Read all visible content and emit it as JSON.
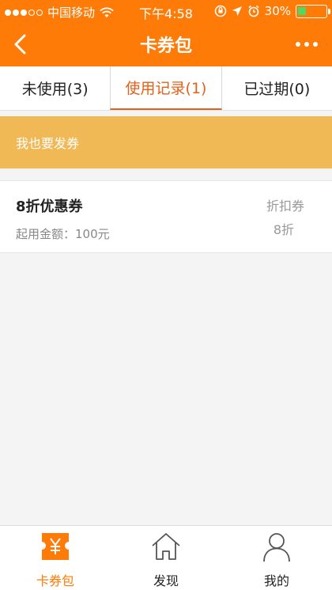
{
  "status_bar": {
    "carrier": "中国移动",
    "time": "下午4:58",
    "battery_percent": "30%",
    "battery_level": 0.3
  },
  "nav": {
    "title": "卡券包"
  },
  "tabs": [
    {
      "label": "未使用(3)",
      "active": false
    },
    {
      "label": "使用记录(1)",
      "active": true
    },
    {
      "label": "已过期(0)",
      "active": false
    }
  ],
  "banner": {
    "text": "我也要发券"
  },
  "coupons": [
    {
      "title": "8折优惠券",
      "min_amount": "起用金额：100元",
      "type": "折扣券",
      "discount": "8折"
    }
  ],
  "tabbar": [
    {
      "label": "卡券包",
      "icon": "coupon-yen-icon",
      "active": true
    },
    {
      "label": "发现",
      "icon": "home-icon",
      "active": false
    },
    {
      "label": "我的",
      "icon": "person-icon",
      "active": false
    }
  ],
  "colors": {
    "brand": "#ff7b07",
    "banner": "#f0b955",
    "active_tab": "#e0621b"
  }
}
